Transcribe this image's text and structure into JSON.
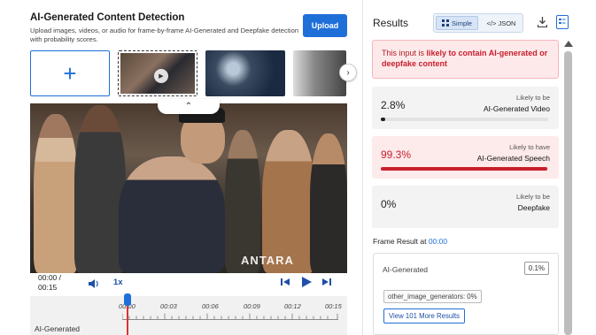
{
  "left": {
    "title": "AI-Generated Content Detection",
    "subtitle": "Upload images, videos, or audio for frame-by-frame AI-Generated and Deepfake detection with probability scores.",
    "upload_label": "Upload",
    "add_label": "+",
    "collapse_label": "⌃",
    "next_label": "›",
    "watermark": "ANTARA",
    "controls": {
      "time": "00:00 / 00:15",
      "speed": "1x"
    },
    "timeline": {
      "ticks": [
        "00:00",
        "00:03",
        "00:06",
        "00:09",
        "00:12",
        "00:15"
      ],
      "track_label": "AI-Generated"
    }
  },
  "right": {
    "title": "Results",
    "toggle": {
      "simple": "Simple",
      "json": "</> JSON"
    },
    "alert_prefix": "This input is ",
    "alert_emph": "likely to contain AI-generated or deepfake content",
    "metrics": [
      {
        "value": "2.8%",
        "label1": "Likely to be",
        "label2": "AI-Generated Video",
        "fraction": 0.028
      },
      {
        "value": "99.3%",
        "label1": "Likely to have",
        "label2": "AI-Generated Speech",
        "fraction": 0.993
      },
      {
        "value": "0%",
        "label1": "Likely to be",
        "label2": "Deepfake",
        "fraction": 0.0
      }
    ],
    "frame": {
      "header_prefix": "Frame Result at ",
      "header_time": "00:00",
      "label": "AI-Generated",
      "pct": "0.1%",
      "tag": "other_image_generators: 0%",
      "more": "View 101 More Results"
    }
  },
  "colors": {
    "accent": "#1f6fd8",
    "danger": "#c81e2c",
    "alert_bg": "#fde9ea"
  }
}
